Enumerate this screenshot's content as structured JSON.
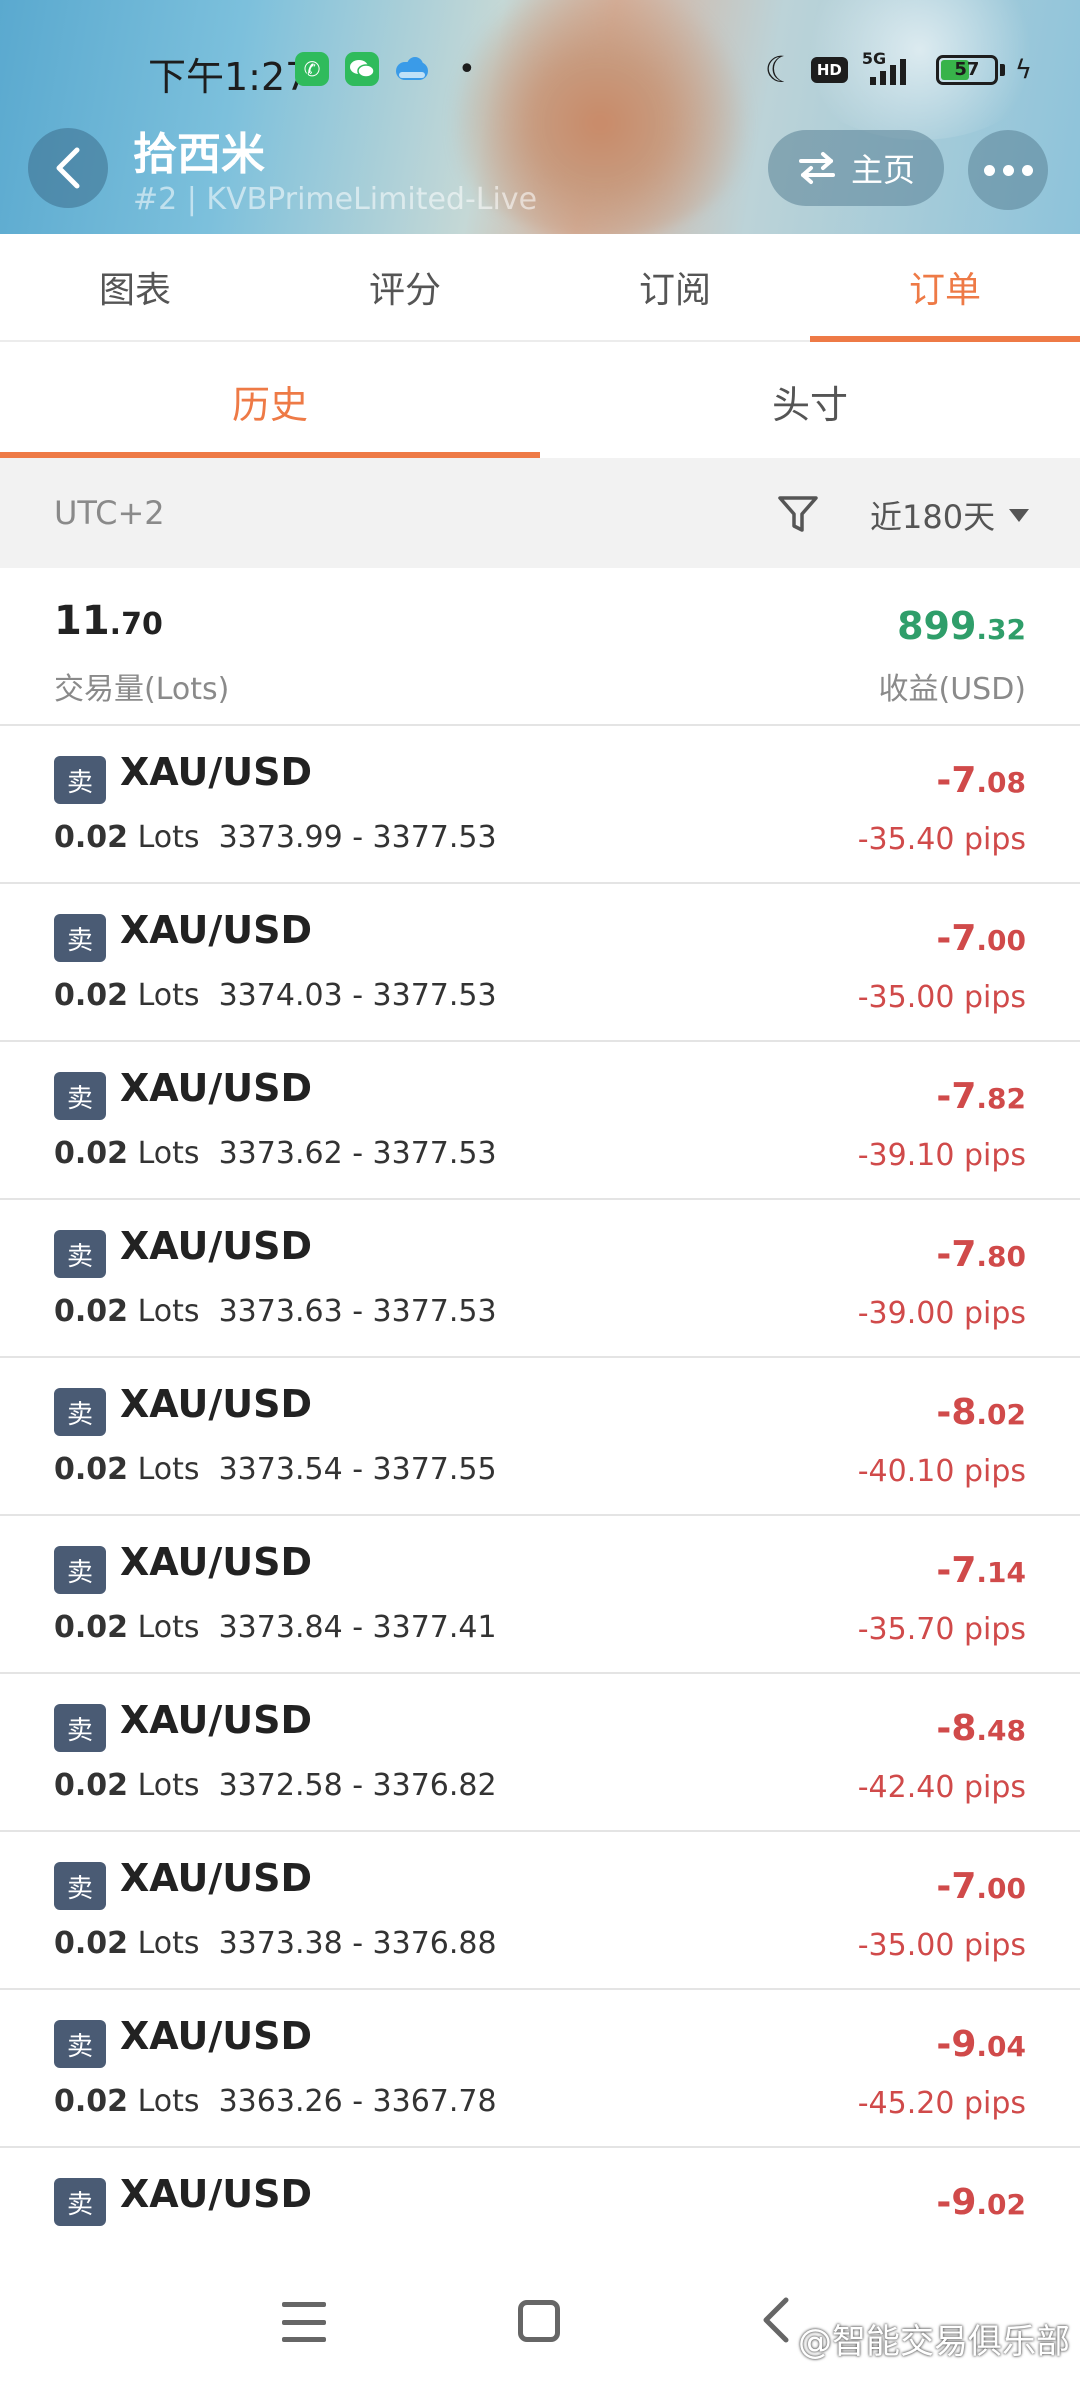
{
  "status_bar": {
    "time": "下午1:27",
    "network": "5G",
    "battery": "57",
    "battery_level": 0.57,
    "hd_label": "HD",
    "icons": [
      "phone-app-icon",
      "wechat-app-icon",
      "cloud-app-icon",
      "moon-icon",
      "hd-icon",
      "signal-icon",
      "battery-icon",
      "charging-icon"
    ]
  },
  "header": {
    "title": "拾西米",
    "subtitle": "#2 | KVBPrimeLimited-Live",
    "home_label": "主页"
  },
  "main_tabs": [
    {
      "label": "图表",
      "active": false
    },
    {
      "label": "评分",
      "active": false
    },
    {
      "label": "订阅",
      "active": false
    },
    {
      "label": "订单",
      "active": true
    }
  ],
  "sub_tabs": [
    {
      "label": "历史",
      "active": true
    },
    {
      "label": "头寸",
      "active": false
    }
  ],
  "filter": {
    "timezone": "UTC+2",
    "range": "近180天"
  },
  "summary": {
    "volume_int": "11",
    "volume_dec": ".70",
    "volume_label": "交易量(Lots)",
    "profit_int": "899",
    "profit_dec": ".32",
    "profit_label": "收益(USD)"
  },
  "colors": {
    "accent": "#ee7a46",
    "profit": "#2f9e6a",
    "loss": "#d04a4a",
    "sell_badge": "#4a5b74"
  },
  "orders": [
    {
      "side": "卖",
      "symbol": "XAU/USD",
      "lots": "0.02",
      "lots_unit": "Lots",
      "prices": "3373.99 - 3377.53",
      "pnl_int": "-7",
      "pnl_dec": ".08",
      "pips": "-35.40 pips"
    },
    {
      "side": "卖",
      "symbol": "XAU/USD",
      "lots": "0.02",
      "lots_unit": "Lots",
      "prices": "3374.03 - 3377.53",
      "pnl_int": "-7",
      "pnl_dec": ".00",
      "pips": "-35.00 pips"
    },
    {
      "side": "卖",
      "symbol": "XAU/USD",
      "lots": "0.02",
      "lots_unit": "Lots",
      "prices": "3373.62 - 3377.53",
      "pnl_int": "-7",
      "pnl_dec": ".82",
      "pips": "-39.10 pips"
    },
    {
      "side": "卖",
      "symbol": "XAU/USD",
      "lots": "0.02",
      "lots_unit": "Lots",
      "prices": "3373.63 - 3377.53",
      "pnl_int": "-7",
      "pnl_dec": ".80",
      "pips": "-39.00 pips"
    },
    {
      "side": "卖",
      "symbol": "XAU/USD",
      "lots": "0.02",
      "lots_unit": "Lots",
      "prices": "3373.54 - 3377.55",
      "pnl_int": "-8",
      "pnl_dec": ".02",
      "pips": "-40.10 pips"
    },
    {
      "side": "卖",
      "symbol": "XAU/USD",
      "lots": "0.02",
      "lots_unit": "Lots",
      "prices": "3373.84 - 3377.41",
      "pnl_int": "-7",
      "pnl_dec": ".14",
      "pips": "-35.70 pips"
    },
    {
      "side": "卖",
      "symbol": "XAU/USD",
      "lots": "0.02",
      "lots_unit": "Lots",
      "prices": "3372.58 - 3376.82",
      "pnl_int": "-8",
      "pnl_dec": ".48",
      "pips": "-42.40 pips"
    },
    {
      "side": "卖",
      "symbol": "XAU/USD",
      "lots": "0.02",
      "lots_unit": "Lots",
      "prices": "3373.38 - 3376.88",
      "pnl_int": "-7",
      "pnl_dec": ".00",
      "pips": "-35.00 pips"
    },
    {
      "side": "卖",
      "symbol": "XAU/USD",
      "lots": "0.02",
      "lots_unit": "Lots",
      "prices": "3363.26 - 3367.78",
      "pnl_int": "-9",
      "pnl_dec": ".04",
      "pips": "-45.20 pips"
    },
    {
      "side": "卖",
      "symbol": "XAU/USD",
      "lots": "",
      "lots_unit": "",
      "prices": "",
      "pnl_int": "-9",
      "pnl_dec": ".02",
      "pips": ""
    }
  ],
  "watermark": "@智能交易俱乐部"
}
